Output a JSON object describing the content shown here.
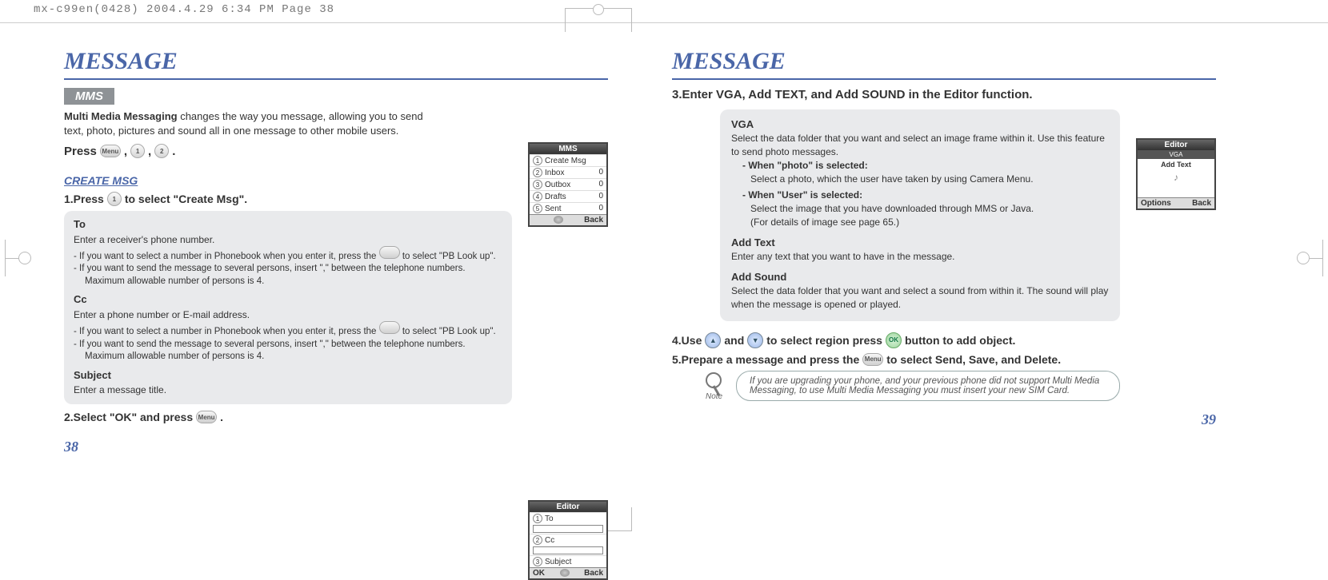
{
  "header": "mx-c99en(0428)  2004.4.29  6:34 PM  Page 38",
  "left": {
    "title": "MESSAGE",
    "mms_tag": "MMS",
    "intro_bold": "Multi Media Messaging",
    "intro_rest": " changes the way you message, allowing you to send text, photo, pictures and sound all in one message to other mobile users.",
    "press_prefix": "Press ",
    "press_comma": ",",
    "press_period": ".",
    "btn_menu": "Menu",
    "btn_1": "1",
    "btn_2": "2",
    "subhead": "CREATE MSG",
    "step1_a": "1.Press ",
    "step1_b": " to select \"Create Msg\".",
    "box": {
      "to_t": "To",
      "to_1": "Enter a receiver's phone number.",
      "to_2a": "- If you want to select a number in Phonebook when you enter it, press the ",
      "to_2b": " to select \"PB Look up\".",
      "to_3": "- If you want to send the message to several persons, insert \",\" between the telephone numbers.",
      "to_4": "Maximum allowable number of persons is 4.",
      "cc_t": "Cc",
      "cc_1": "Enter a phone number or E-mail address.",
      "cc_2a": "- If you want to select a number in Phonebook when you enter it, press the ",
      "cc_2b": " to select \"PB Look up\".",
      "cc_3": "- If you want to send the message to several persons, insert \",\" between the telephone numbers.",
      "cc_4": "Maximum allowable number of persons is 4.",
      "subj_t": "Subject",
      "subj_1": "Enter a message title."
    },
    "step2_a": "2.Select \"OK\" and press ",
    "step2_b": ".",
    "page_num": "38",
    "mock_mms": {
      "title": "MMS",
      "items": [
        {
          "n": "1",
          "label": "Create Msg",
          "val": ""
        },
        {
          "n": "2",
          "label": "Inbox",
          "val": "0"
        },
        {
          "n": "3",
          "label": "Outbox",
          "val": "0"
        },
        {
          "n": "4",
          "label": "Drafts",
          "val": "0"
        },
        {
          "n": "5",
          "label": "Sent",
          "val": "0"
        }
      ],
      "back": "Back"
    },
    "mock_editor": {
      "title": "Editor",
      "items": [
        {
          "n": "1",
          "label": "To"
        },
        {
          "n": "2",
          "label": "Cc"
        },
        {
          "n": "3",
          "label": "Subject"
        }
      ],
      "ok": "OK",
      "back": "Back"
    }
  },
  "right": {
    "title": "MESSAGE",
    "step3": "3.Enter VGA, Add TEXT, and Add SOUND in the Editor function.",
    "box": {
      "vga_t": "VGA",
      "vga_1": "Select the data folder that you want and select an image frame within it. Use this feature to send photo messages.",
      "vga_photo_t": "- When \"photo\" is selected:",
      "vga_photo_b": "Select a photo, which the user have taken by using Camera Menu.",
      "vga_user_t": "- When \"User\" is selected:",
      "vga_user_b1": "Select the image that you have downloaded through MMS or Java.",
      "vga_user_b2": "(For details of image see page 65.)",
      "addtext_t": "Add Text",
      "addtext_b": "Enter any text that you want to have in the message.",
      "addsound_t": "Add Sound",
      "addsound_b": "Select the data folder that you want and select a sound from within it. The sound will play when the message is opened or played."
    },
    "step4_a": "4.Use ",
    "step4_b": " and ",
    "step4_c": " to select region press ",
    "step4_d": " button to add object.",
    "step5_a": "5.Prepare a message and press the ",
    "step5_b": " to select Send, Save, and Delete.",
    "note_label": "Note",
    "note": "If you are upgrading your phone, and your previous phone did not support Multi Media Messaging, to use Multi Media Messaging you must insert your new SIM Card.",
    "page_num": "39",
    "mock_editor2": {
      "title": "Editor",
      "vga": "VGA",
      "addtext": "Add Text",
      "options": "Options",
      "back": "Back"
    }
  }
}
